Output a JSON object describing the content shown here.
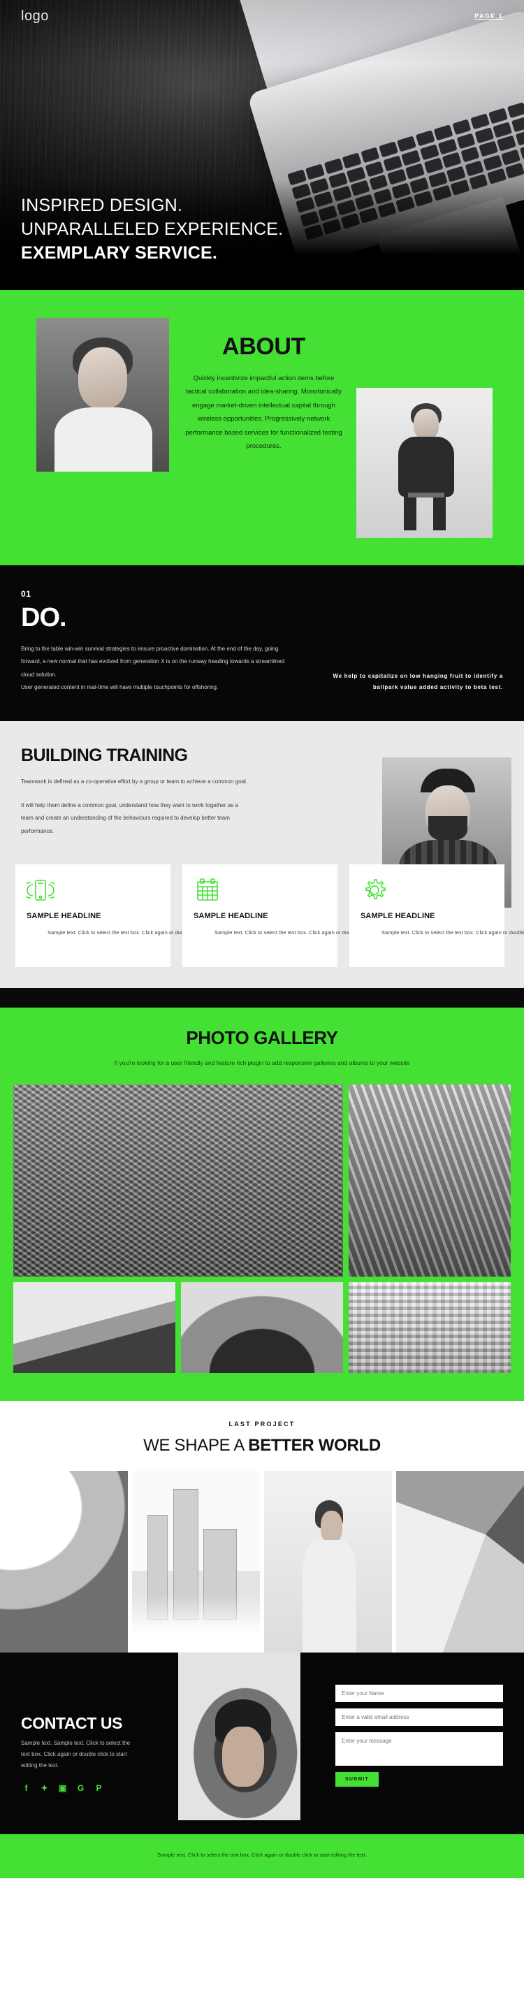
{
  "hero": {
    "logo": "logo",
    "nav_link": "PAGE 1",
    "headline_line1": "INSPIRED DESIGN.",
    "headline_line2": "UNPARALLELED EXPERIENCE.",
    "headline_line3": "EXEMPLARY SERVICE."
  },
  "about": {
    "title": "ABOUT",
    "body": "Quickly incentivize impactful action items before tactical collaboration and idea-sharing. Monotonically engage market-driven intellectual capital through wireless opportunities. Progressively network performance based services for functionalized testing procedures."
  },
  "do": {
    "number": "01",
    "title": "DO.",
    "paragraph1": "Bring to the table win-win survival strategies to ensure proactive domination. At the end of the day, going forward, a new normal that has evolved from generation X is on the runway heading towards a streamlined cloud solution.",
    "paragraph2": "User generated content in real-time will have multiple touchpoints for offshoring.",
    "side_note": "We help to capitalize on low hanging fruit to identify a ballpark value added activity to beta test."
  },
  "building_training": {
    "title": "BUILDING TRAINING",
    "paragraph1": "Teamwork is defined as a co-operative effort by a group or team to achieve a common goal.",
    "paragraph2": "It will help them define a common goal, understand how they want to work together as a team and create an understanding of the behaviours required to develop better team performance.",
    "cards": [
      {
        "icon": "mobile-signal-icon",
        "headline": "SAMPLE HEADLINE",
        "text": "Sample text. Click to select the text box. Click again or double click to start editing the text."
      },
      {
        "icon": "calendar-icon",
        "headline": "SAMPLE HEADLINE",
        "text": "Sample text. Click to select the text box. Click again or double click to start editing the text."
      },
      {
        "icon": "gear-icon",
        "headline": "SAMPLE HEADLINE",
        "text": "Sample text. Click to select the text box. Click again or double click to start editing the text."
      }
    ]
  },
  "gallery": {
    "title": "PHOTO GALLERY",
    "subtitle": "If you're looking for a user friendly and feature rich plugin to add responsive galleries and albums to your website",
    "tiles": [
      {
        "name": "eiffel-tower-photo"
      },
      {
        "name": "driftwood-sculpture-photo"
      },
      {
        "name": "mountain-photo"
      },
      {
        "name": "curved-architecture-photo"
      },
      {
        "name": "glass-building-photo"
      }
    ]
  },
  "last_project": {
    "kicker": "LAST PROJECT",
    "title_light": "WE SHAPE A ",
    "title_bold": "BETTER WORLD",
    "tiles": [
      {
        "name": "concert-hall-photo"
      },
      {
        "name": "foggy-city-photo"
      },
      {
        "name": "person-looking-up-photo"
      },
      {
        "name": "spiral-staircase-photo"
      }
    ]
  },
  "contact": {
    "title": "CONTACT US",
    "text": "Sample text. Sample text. Click to select the text box. Click again or double click to start editing the text.",
    "socials": [
      {
        "name": "facebook-icon",
        "glyph": "f"
      },
      {
        "name": "twitter-icon",
        "glyph": "✦"
      },
      {
        "name": "instagram-icon",
        "glyph": "▣"
      },
      {
        "name": "google-plus-icon",
        "glyph": "G"
      },
      {
        "name": "pinterest-icon",
        "glyph": "P"
      }
    ],
    "form": {
      "name_placeholder": "Enter your Name",
      "email_placeholder": "Enter a valid email address",
      "message_placeholder": "Enter your message",
      "submit_label": "SUBMIT"
    }
  },
  "footer": {
    "text": "Sample text. Click to select the text box. Click again or double click to start editing the text."
  },
  "colors": {
    "accent_green": "#44E033",
    "dark": "#070707",
    "light_gray": "#e9e9e9"
  }
}
